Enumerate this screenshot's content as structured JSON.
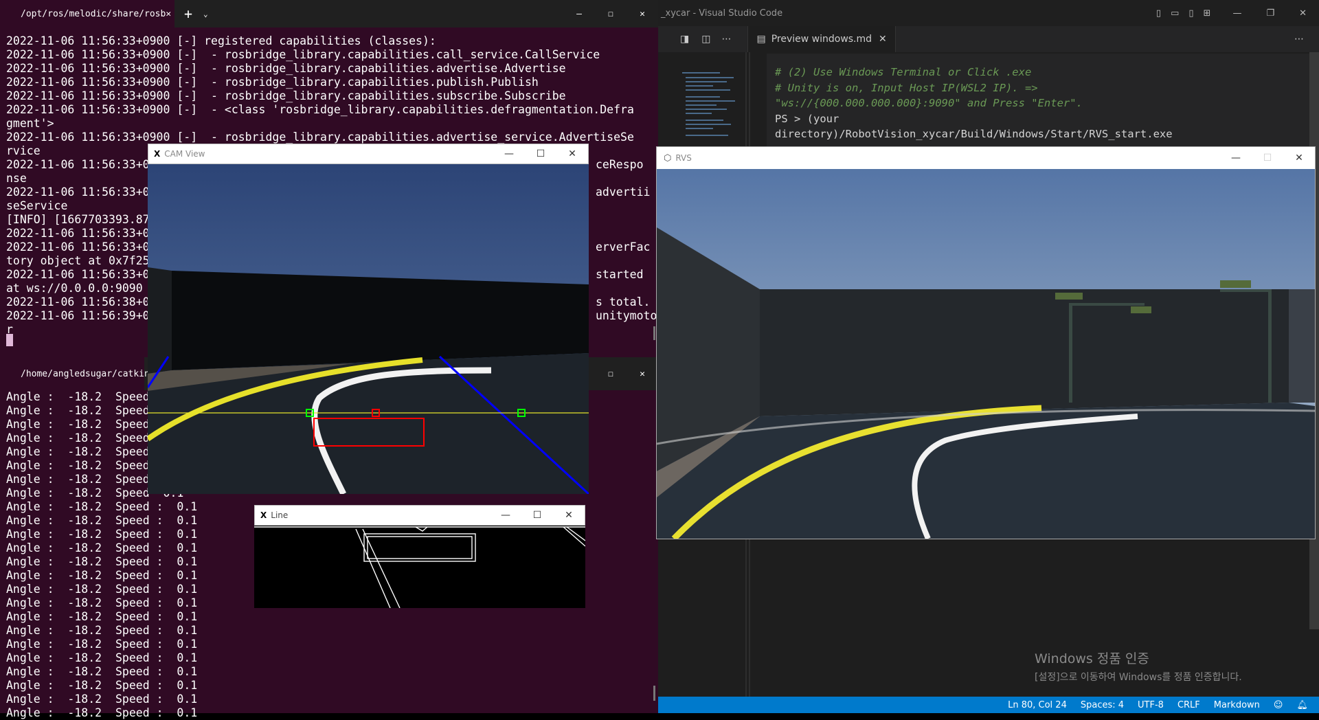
{
  "terminal_top": {
    "tab_title": "/opt/ros/melodic/share/rosb",
    "visible_lines": [
      "2022-11-06 11:56:33+0900 [-] registered capabilities (classes):",
      "2022-11-06 11:56:33+0900 [-]  - rosbridge_library.capabilities.call_service.CallService",
      "2022-11-06 11:56:33+0900 [-]  - rosbridge_library.capabilities.advertise.Advertise",
      "2022-11-06 11:56:33+0900 [-]  - rosbridge_library.capabilities.publish.Publish",
      "2022-11-06 11:56:33+0900 [-]  - rosbridge_library.capabilities.subscribe.Subscribe",
      "2022-11-06 11:56:33+0900 [-]  - <class 'rosbridge_library.capabilities.defragmentation.Defra",
      "gment'>",
      "2022-11-06 11:56:33+0900 [-]  - rosbridge_library.capabilities.advertise_service.AdvertiseSe",
      "rvice"
    ],
    "left_fragments": [
      "2022-11-06 11:56:33+0",
      "nse",
      "2022-11-06 11:56:33+0",
      "seService",
      "[INFO] [1667703393.87",
      "2022-11-06 11:56:33+0",
      "2022-11-06 11:56:33+0",
      "tory object at 0x7f25",
      "2022-11-06 11:56:33+0",
      "at ws://0.0.0.0:9090",
      "2022-11-06 11:56:38+0",
      "2022-11-06 11:56:39+0",
      "r"
    ],
    "right_fragments": [
      "ceRespo",
      "",
      "advertii",
      "",
      "",
      "",
      "erverFac",
      "",
      "started",
      "",
      "s total.",
      "unitymoto",
      ""
    ]
  },
  "terminal_bottom": {
    "tab_title": "/home/angledsugar/catkin_w",
    "rows": [
      {
        "label": "Angle :",
        "angle": "-18.2",
        "speed_label": "Speed",
        "speed": ""
      },
      {
        "label": "Angle :",
        "angle": "-18.2",
        "speed_label": "Speed",
        "speed": ""
      },
      {
        "label": "Angle :",
        "angle": "-18.2",
        "speed_label": "Speed",
        "speed": ""
      },
      {
        "label": "Angle :",
        "angle": "-18.2",
        "speed_label": "Speed",
        "speed": ""
      },
      {
        "label": "Angle :",
        "angle": "-18.2",
        "speed_label": "Speed",
        "speed": ""
      },
      {
        "label": "Angle :",
        "angle": "-18.2",
        "speed_label": "Speed",
        "speed": ""
      },
      {
        "label": "Angle :",
        "angle": "-18.2",
        "speed_label": "Speed",
        "speed": ""
      },
      {
        "label": "Angle :",
        "angle": "-18.2",
        "speed_label": "Speed",
        "speed": "0.1"
      },
      {
        "label": "Angle :",
        "angle": "-18.2",
        "speed_label": "Speed :",
        "speed": "0.1"
      },
      {
        "label": "Angle :",
        "angle": "-18.2",
        "speed_label": "Speed :",
        "speed": "0.1"
      },
      {
        "label": "Angle :",
        "angle": "-18.2",
        "speed_label": "Speed :",
        "speed": "0.1"
      },
      {
        "label": "Angle :",
        "angle": "-18.2",
        "speed_label": "Speed :",
        "speed": "0.1"
      },
      {
        "label": "Angle :",
        "angle": "-18.2",
        "speed_label": "Speed :",
        "speed": "0.1"
      },
      {
        "label": "Angle :",
        "angle": "-18.2",
        "speed_label": "Speed :",
        "speed": "0.1"
      },
      {
        "label": "Angle :",
        "angle": "-18.2",
        "speed_label": "Speed :",
        "speed": "0.1"
      },
      {
        "label": "Angle :",
        "angle": "-18.2",
        "speed_label": "Speed :",
        "speed": "0.1"
      },
      {
        "label": "Angle :",
        "angle": "-18.2",
        "speed_label": "Speed :",
        "speed": "0.1"
      },
      {
        "label": "Angle :",
        "angle": "-18.2",
        "speed_label": "Speed :",
        "speed": "0.1"
      },
      {
        "label": "Angle :",
        "angle": "-18.2",
        "speed_label": "Speed :",
        "speed": "0.1"
      },
      {
        "label": "Angle :",
        "angle": "-18.2",
        "speed_label": "Speed :",
        "speed": "0.1"
      },
      {
        "label": "Angle :",
        "angle": "-18.2",
        "speed_label": "Speed :",
        "speed": "0.1"
      },
      {
        "label": "Angle :",
        "angle": "-18.2",
        "speed_label": "Speed :",
        "speed": "0.1"
      },
      {
        "label": "Angle :",
        "angle": "-18.2",
        "speed_label": "Speed :",
        "speed": "0.1"
      },
      {
        "label": "Angle :",
        "angle": "-18.2",
        "speed_label": "Speed :",
        "speed": "0.1"
      }
    ]
  },
  "cam_view": {
    "title": "CAM View"
  },
  "line_window": {
    "title": "Line"
  },
  "rvs_window": {
    "title": "RVS"
  },
  "vscode": {
    "window_title": "_xycar - Visual Studio Code",
    "tab_label": "Preview windows.md",
    "preview_lines": [
      "# (2) Use Windows Terminal or Click .exe",
      "# Unity is on, Input Host IP(WSL2 IP). =>",
      "\"ws://{000.000.000.000}:9090\" and Press \"Enter\".",
      "PS > (your",
      "directory)/RobotVision_xycar/Build/Windows/Start/RVS_start.exe"
    ],
    "status": {
      "position": "Ln 80, Col 24",
      "spaces": "Spaces: 4",
      "encoding": "UTF-8",
      "eol": "CRLF",
      "language": "Markdown"
    },
    "watermark_title": "Windows 정품 인증",
    "watermark_sub": "[설정]으로 이동하여 Windows를 정품 인증합니다."
  },
  "colors": {
    "terminal_bg": "#300a24",
    "vscode_bg": "#1e1e1e",
    "status_bar": "#007acc",
    "ubuntu_orange": "#e95420"
  }
}
